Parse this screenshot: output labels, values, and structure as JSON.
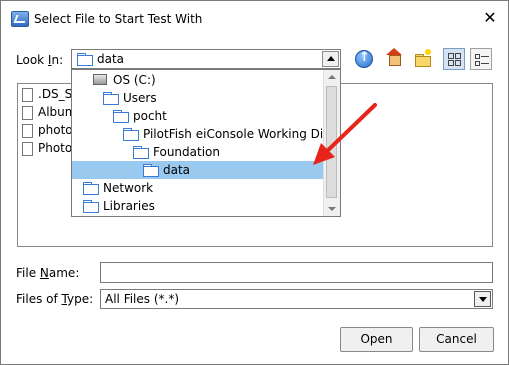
{
  "window": {
    "title": "Select File to Start Test With",
    "close_glyph": "✕"
  },
  "look_in": {
    "label_prefix": "Look ",
    "label_underline": "I",
    "label_suffix": "n:",
    "selected": "data"
  },
  "toolbar": {
    "buttons": [
      "up-one-level-icon",
      "home-icon",
      "new-folder-icon",
      "list-view-icon",
      "details-view-icon"
    ]
  },
  "file_list": {
    "items": [
      ".DS_S",
      "Album",
      "photos",
      "Photo"
    ]
  },
  "dropdown": {
    "items": [
      {
        "label": "OS (C:)",
        "icon": "drive-icon",
        "indent": 0,
        "selected": false
      },
      {
        "label": "Users",
        "icon": "folder-icon",
        "indent": 1,
        "selected": false
      },
      {
        "label": "pocht",
        "icon": "folder-icon",
        "indent": 2,
        "selected": false
      },
      {
        "label": "PilotFish eiConsole Working Dire",
        "icon": "folder-icon",
        "indent": 3,
        "selected": false
      },
      {
        "label": "Foundation",
        "icon": "folder-icon",
        "indent": 4,
        "selected": false
      },
      {
        "label": "data",
        "icon": "folder-icon",
        "indent": 5,
        "selected": true
      },
      {
        "label": "Network",
        "icon": "folder-icon",
        "indent": 0,
        "selected": false
      },
      {
        "label": "Libraries",
        "icon": "folder-icon",
        "indent": 0,
        "selected": false
      }
    ],
    "highlight_color": "#99c9ef"
  },
  "annotation": {
    "arrow_color": "#e8231a"
  },
  "file_name": {
    "label_prefix": "File ",
    "label_underline": "N",
    "label_suffix": "ame:",
    "value": ""
  },
  "files_of_type": {
    "label_prefix": "Files of ",
    "label_underline": "T",
    "label_suffix": "ype:",
    "selected": "All Files (*.*)"
  },
  "buttons": {
    "open": "Open",
    "cancel": "Cancel"
  }
}
